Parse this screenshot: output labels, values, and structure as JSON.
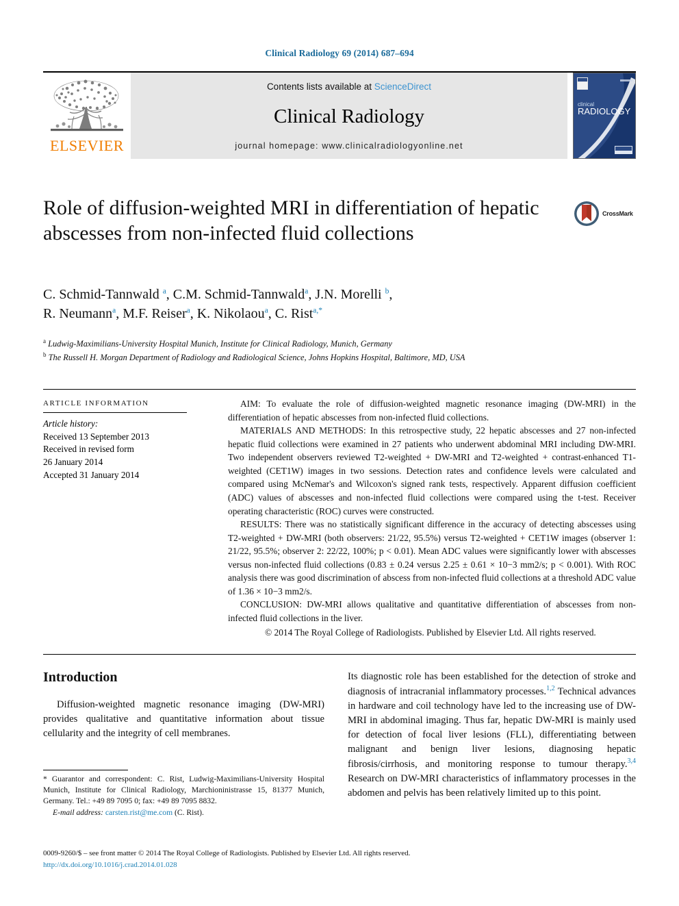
{
  "running_head": "Clinical Radiology 69 (2014) 687–694",
  "masthead": {
    "publisher_name": "ELSEVIER",
    "publisher_logo_icon": "elsevier-tree-icon",
    "contents_prefix": "Contents lists available at ",
    "contents_link": "ScienceDirect",
    "journal_name": "Clinical Radiology",
    "homepage_label": "journal homepage: www.clinicalradiologyonline.net",
    "cover_title_small": "clinical",
    "cover_title_large": "RADIOLOGY",
    "cover_icon": "journal-cover-icon"
  },
  "article": {
    "title": "Role of diffusion-weighted MRI in differentiation of hepatic abscesses from non-infected fluid collections",
    "crossmark_label": "CrossMark",
    "authors_line1": "C. Schmid-Tannwald a, C.M. Schmid-Tannwald a, J.N. Morelli b,",
    "authors_line2": "R. Neumann a, M.F. Reiser a, K. Nikolaou a, C. Rist a,*",
    "affiliation_a": "Ludwig-Maximilians-University Hospital Munich, Institute for Clinical Radiology, Munich, Germany",
    "affiliation_b": "The Russell H. Morgan Department of Radiology and Radiological Science, Johns Hopkins Hospital, Baltimore, MD, USA"
  },
  "article_information": {
    "heading": "ARTICLE INFORMATION",
    "history_label": "Article history:",
    "history_lines": [
      "Received 13 September 2013",
      "Received in revised form",
      "26 January 2014",
      "Accepted 31 January 2014"
    ]
  },
  "abstract": {
    "aim_label": "AIM:",
    "aim_text": " To evaluate the role of diffusion-weighted magnetic resonance imaging (DW-MRI) in the differentiation of hepatic abscesses from non-infected fluid collections.",
    "materials_label": "MATERIALS AND METHODS:",
    "materials_text": " In this retrospective study, 22 hepatic abscesses and 27 non-infected hepatic fluid collections were examined in 27 patients who underwent abdominal MRI including DW-MRI. Two independent observers reviewed T2-weighted + DW-MRI and T2-weighted + contrast-enhanced T1-weighted (CET1W) images in two sessions. Detection rates and confidence levels were calculated and compared using McNemar's and Wilcoxon's signed rank tests, respectively. Apparent diffusion coefficient (ADC) values of abscesses and non-infected fluid collections were compared using the t-test. Receiver operating characteristic (ROC) curves were constructed.",
    "results_label": "RESULTS:",
    "results_text": " There was no statistically significant difference in the accuracy of detecting abscesses using T2-weighted + DW-MRI (both observers: 21/22, 95.5%) versus T2-weighted + CET1W images (observer 1: 21/22, 95.5%; observer 2: 22/22, 100%; p < 0.01). Mean ADC values were significantly lower with abscesses versus non-infected fluid collections (0.83 ± 0.24 versus 2.25 ± 0.61 × 10−3 mm2/s; p < 0.001). With ROC analysis there was good discrimination of abscess from non-infected fluid collections at a threshold ADC value of 1.36 × 10−3 mm2/s.",
    "conclusion_label": "CONCLUSION:",
    "conclusion_text": " DW-MRI allows qualitative and quantitative differentiation of abscesses from non-infected fluid collections in the liver.",
    "copyright": "© 2014 The Royal College of Radiologists. Published by Elsevier Ltd. All rights reserved."
  },
  "body": {
    "introduction_heading": "Introduction",
    "left_paragraph": "Diffusion-weighted magnetic resonance imaging (DW-MRI) provides qualitative and quantitative information about tissue cellularity and the integrity of cell membranes.",
    "right_paragraph_part1": "Its diagnostic role has been established for the detection of stroke and diagnosis of intracranial inflammatory processes.",
    "right_ref1": "1,2",
    "right_paragraph_part2": " Technical advances in hardware and coil technology have led to the increasing use of DW-MRI in abdominal imaging. Thus far, hepatic DW-MRI is mainly used for detection of focal liver lesions (FLL), differentiating between malignant and benign liver lesions, diagnosing hepatic fibrosis/cirrhosis, and monitoring response to tumour therapy.",
    "right_ref2": "3,4",
    "right_paragraph_part3": " Research on DW-MRI characteristics of inflammatory processes in the abdomen and pelvis has been relatively limited up to this point."
  },
  "footnote": {
    "marker": "*",
    "text": " Guarantor and correspondent: C. Rist, Ludwig-Maximilians-University Hospital Munich, Institute for Clinical Radiology, Marchioninistrasse 15, 81377 Munich, Germany. Tel.: +49 89 7095 0; fax: +49 89 7095 8832.",
    "email_label": "E-mail address:",
    "email": "carsten.rist@me.com",
    "email_suffix": " (C. Rist)."
  },
  "bottom": {
    "front_matter": "0009-9260/$ – see front matter © 2014 The Royal College of Radiologists. Published by Elsevier Ltd. All rights reserved.",
    "doi": "http://dx.doi.org/10.1016/j.crad.2014.01.028"
  },
  "colors": {
    "link_blue": "#1b7fb5",
    "sciencedirect_blue": "#3c93d0",
    "elsevier_orange": "#f07d00",
    "band_grey": "#e6e6e6",
    "cover_navy": "#2e4e87"
  }
}
